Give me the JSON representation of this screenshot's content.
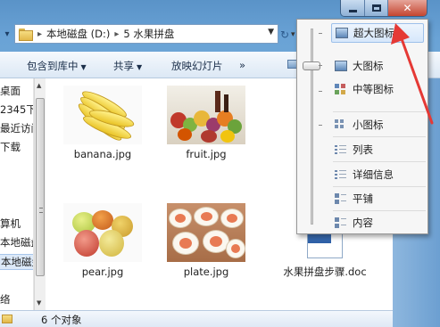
{
  "address": {
    "crumbs": [
      "本地磁盘 (D:)",
      "5 水果拼盘"
    ]
  },
  "toolbar": {
    "include_library": "包含到库中",
    "share": "共享",
    "slideshow": "放映幻灯片",
    "more": "»"
  },
  "sidebar": {
    "items": [
      "桌面",
      "2345下",
      "最近访问",
      "下载",
      "算机",
      "本地磁盘",
      "本地磁盘",
      "络"
    ]
  },
  "files": [
    {
      "name": "banana.jpg"
    },
    {
      "name": "fruit.jpg"
    },
    {
      "name": "pear.jpg"
    },
    {
      "name": "plate.jpg"
    },
    {
      "name": "水果拼盘步骤.doc"
    }
  ],
  "status": {
    "count": "6 个对象"
  },
  "view_menu": {
    "items": [
      "超大图标",
      "大图标",
      "中等图标",
      "小图标",
      "列表",
      "详细信息",
      "平铺",
      "内容"
    ],
    "selected": "超大图标"
  },
  "colors": {
    "annotation_arrow": "#e53935",
    "selection": "#d6e7fb"
  }
}
